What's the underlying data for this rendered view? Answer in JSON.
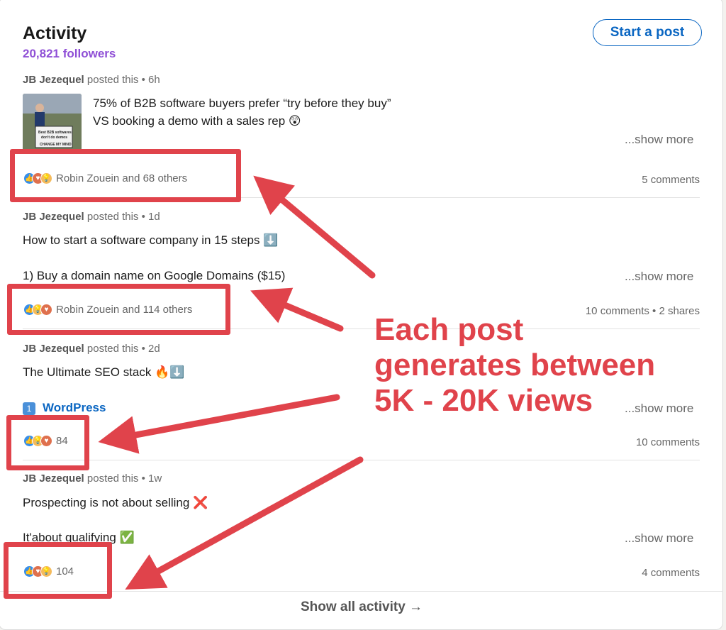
{
  "header": {
    "title": "Activity",
    "followers": "20,821 followers",
    "start_post": "Start a post"
  },
  "posts": [
    {
      "author": "JB Jezequel",
      "action": "posted this",
      "time": "6h",
      "line1": "75% of B2B software buyers prefer “try before they buy”",
      "line2": "VS booking a demo with a sales rep 😲",
      "thumb_text_1": "Best B2B softwares",
      "thumb_text_2": "don't do demos",
      "thumb_text_3": "CHANGE MY MIND",
      "show_more": "...show more",
      "reactions_text": "Robin Zouein and 68 others",
      "counts": "5 comments"
    },
    {
      "author": "JB Jezequel",
      "action": "posted this",
      "time": "1d",
      "line1": "How to start a software company in 15 steps ⬇️",
      "line2": "1) Buy a domain name on Google Domains ($15)",
      "show_more": "...show more",
      "reactions_text": "Robin Zouein and 114 others",
      "counts": "10 comments • 2 shares"
    },
    {
      "author": "JB Jezequel",
      "action": "posted this",
      "time": "2d",
      "line1": "The Ultimate SEO stack 🔥⬇️",
      "line2_badge": "1",
      "line2": "WordPress",
      "show_more": "...show more",
      "reactions_text": "84",
      "counts": "10 comments"
    },
    {
      "author": "JB Jezequel",
      "action": "posted this",
      "time": "1w",
      "line1": "Prospecting is not about selling ❌",
      "line2": "It'about qualifying ✅",
      "show_more": "...show more",
      "reactions_text": "104",
      "counts": "4 comments"
    }
  ],
  "separator": "•",
  "footer": {
    "show_all": "Show all activity →"
  },
  "annotation": {
    "text": "Each post generates between 5K - 20K views",
    "color": "#e0434b"
  },
  "colors": {
    "accent": "#0a66c2",
    "followers": "#8f4fd6",
    "annotation": "#e0434b"
  }
}
